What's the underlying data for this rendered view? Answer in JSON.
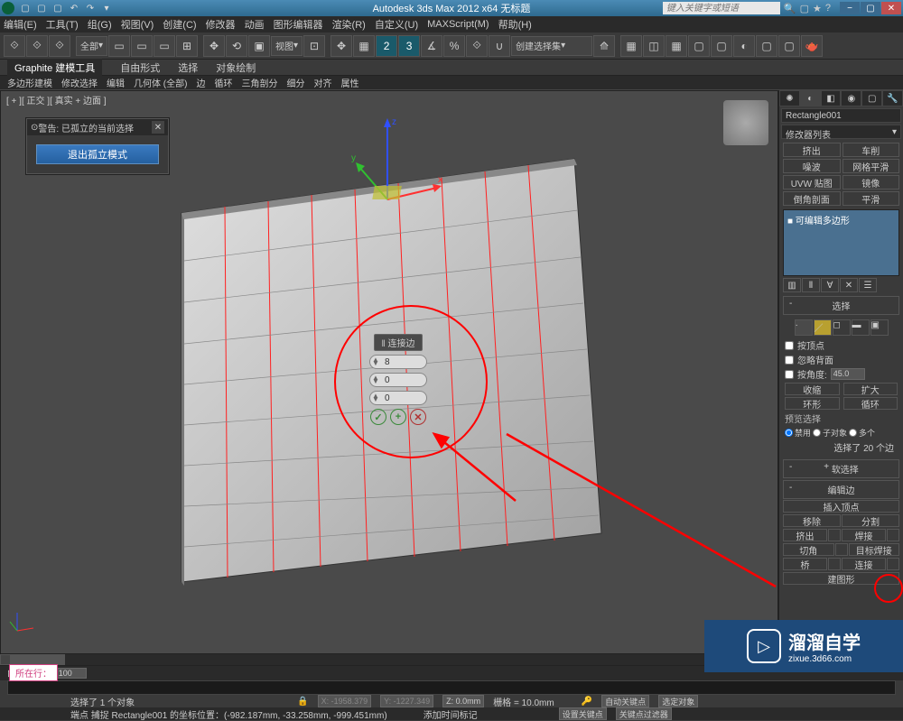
{
  "titlebar": {
    "title": "Autodesk 3ds Max  2012  x64   无标题",
    "search_placeholder": "键入关键字或短语"
  },
  "menu": [
    "编辑(E)",
    "工具(T)",
    "组(G)",
    "视图(V)",
    "创建(C)",
    "修改器",
    "动画",
    "图形编辑器",
    "渲染(R)",
    "自定义(U)",
    "MAXScript(M)",
    "帮助(H)"
  ],
  "toolbar": {
    "scope": "全部",
    "view": "视图",
    "selset": "创建选择集"
  },
  "ribbon": {
    "tabs": [
      "Graphite 建模工具",
      "自由形式",
      "选择",
      "对象绘制"
    ],
    "subtabs": [
      "多边形建模",
      "修改选择",
      "编辑",
      "几何体 (全部)",
      "边",
      "循环",
      "三角剖分",
      "细分",
      "对齐",
      "属性"
    ]
  },
  "viewport": {
    "label": "[ + ][ 正交 ][ 真实 + 边面 ]"
  },
  "warning": {
    "title": "警告: 已孤立的当前选择",
    "exit": "退出孤立模式"
  },
  "caddy": {
    "title": "‖ 连接边",
    "segments": "8",
    "pinch": "0",
    "slide": "0"
  },
  "panel": {
    "obj_name": "Rectangle001",
    "mod_list_label": "修改器列表",
    "quick_btns": [
      [
        "挤出",
        "车削"
      ],
      [
        "噪波",
        "网格平滑"
      ],
      [
        "UVW 贴图",
        "镜像"
      ],
      [
        "倒角剖面",
        "平滑"
      ]
    ],
    "mod_item": "■ 可编辑多边形",
    "rollout_select": "选择",
    "by_vertex": "按顶点",
    "ignore_backfacing": "忽略背面",
    "by_angle": "按角度:",
    "angle": "45.0",
    "shrink": "收缩",
    "grow": "扩大",
    "ring": "环形",
    "loop": "循环",
    "preview_sel": "预览选择",
    "disable": "禁用",
    "subobj": "子对象",
    "multi": "多个",
    "sel_status": "选择了 20 个边",
    "soft_sel": "软选择",
    "edit_edges": "编辑边",
    "insert_vert": "插入顶点",
    "remove": "移除",
    "split": "分割",
    "extrude": "挤出",
    "weld": "焊接",
    "chamfer": "切角",
    "target_weld": "目标焊接",
    "bridge": "桥",
    "connect": "连接",
    "create_shape": "建图形"
  },
  "timeline": {
    "slider": "0 / 100"
  },
  "status": {
    "line1_left": "选择了 1 个对象",
    "line2_left": "端点 捕捉 Rectangle001 的坐标位置：(-982.187mm, -33.258mm, -999.451mm)",
    "x": "X: -1958.379",
    "y": "Y: -1227.349",
    "z": "Z: 0.0mm",
    "grid": "栅格 = 10.0mm",
    "add_marker": "添加时间标记",
    "auto_key": "自动关键点",
    "sel_area": "选定对象",
    "set_key": "设置关键点",
    "key_filters": "关键点过滤器"
  },
  "watermark": {
    "big": "溜溜自学",
    "small": "zixue.3d66.com"
  },
  "tag": "所在行："
}
